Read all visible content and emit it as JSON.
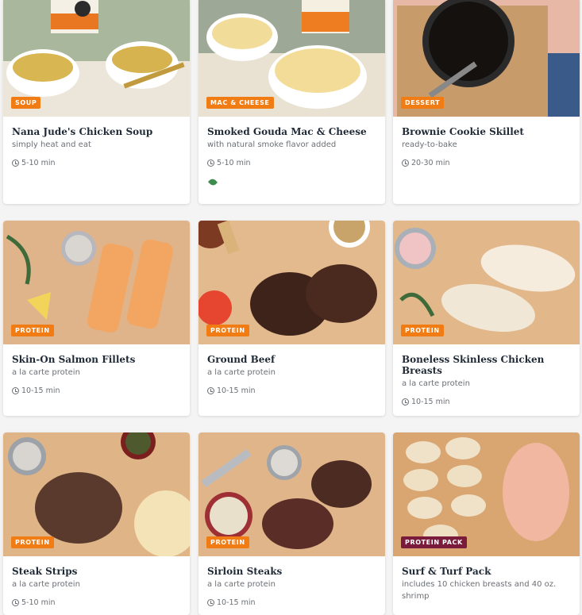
{
  "cards": [
    {
      "badge": "SOUP",
      "badge_color": "#f07c13",
      "title": "Nana Jude's Chicken Soup",
      "subtitle": "simply heat and eat",
      "time": "5-10 min"
    },
    {
      "badge": "MAC & CHEESE",
      "badge_color": "#f07c13",
      "title": "Smoked Gouda Mac & Cheese",
      "subtitle": "with natural smoke flavor added",
      "time": "5-10 min",
      "icon": "leaf-icon"
    },
    {
      "badge": "DESSERT",
      "badge_color": "#f07c13",
      "title": "Brownie Cookie Skillet",
      "subtitle": "ready-to-bake",
      "time": "20-30 min"
    },
    {
      "badge": "PROTEIN",
      "badge_color": "#f07c13",
      "title": "Skin-On Salmon Fillets",
      "subtitle": "a la carte protein",
      "time": "10-15 min"
    },
    {
      "badge": "PROTEIN",
      "badge_color": "#f07c13",
      "title": "Ground Beef",
      "subtitle": "a la carte protein",
      "time": "10-15 min"
    },
    {
      "badge": "PROTEIN",
      "badge_color": "#f07c13",
      "title": "Boneless Skinless Chicken Breasts",
      "subtitle": "a la carte protein",
      "time": "10-15 min"
    },
    {
      "badge": "PROTEIN",
      "badge_color": "#f07c13",
      "title": "Steak Strips",
      "subtitle": "a la carte protein",
      "time": "5-10 min"
    },
    {
      "badge": "PROTEIN",
      "badge_color": "#f07c13",
      "title": "Sirloin Steaks",
      "subtitle": "a la carte protein",
      "time": "10-15 min"
    },
    {
      "badge": "PROTEIN PACK",
      "badge_color": "#7a1b3c",
      "title": "Surf & Turf Pack",
      "subtitle": "includes 10 chicken breasts and 40 oz. shrimp",
      "time": ""
    }
  ]
}
